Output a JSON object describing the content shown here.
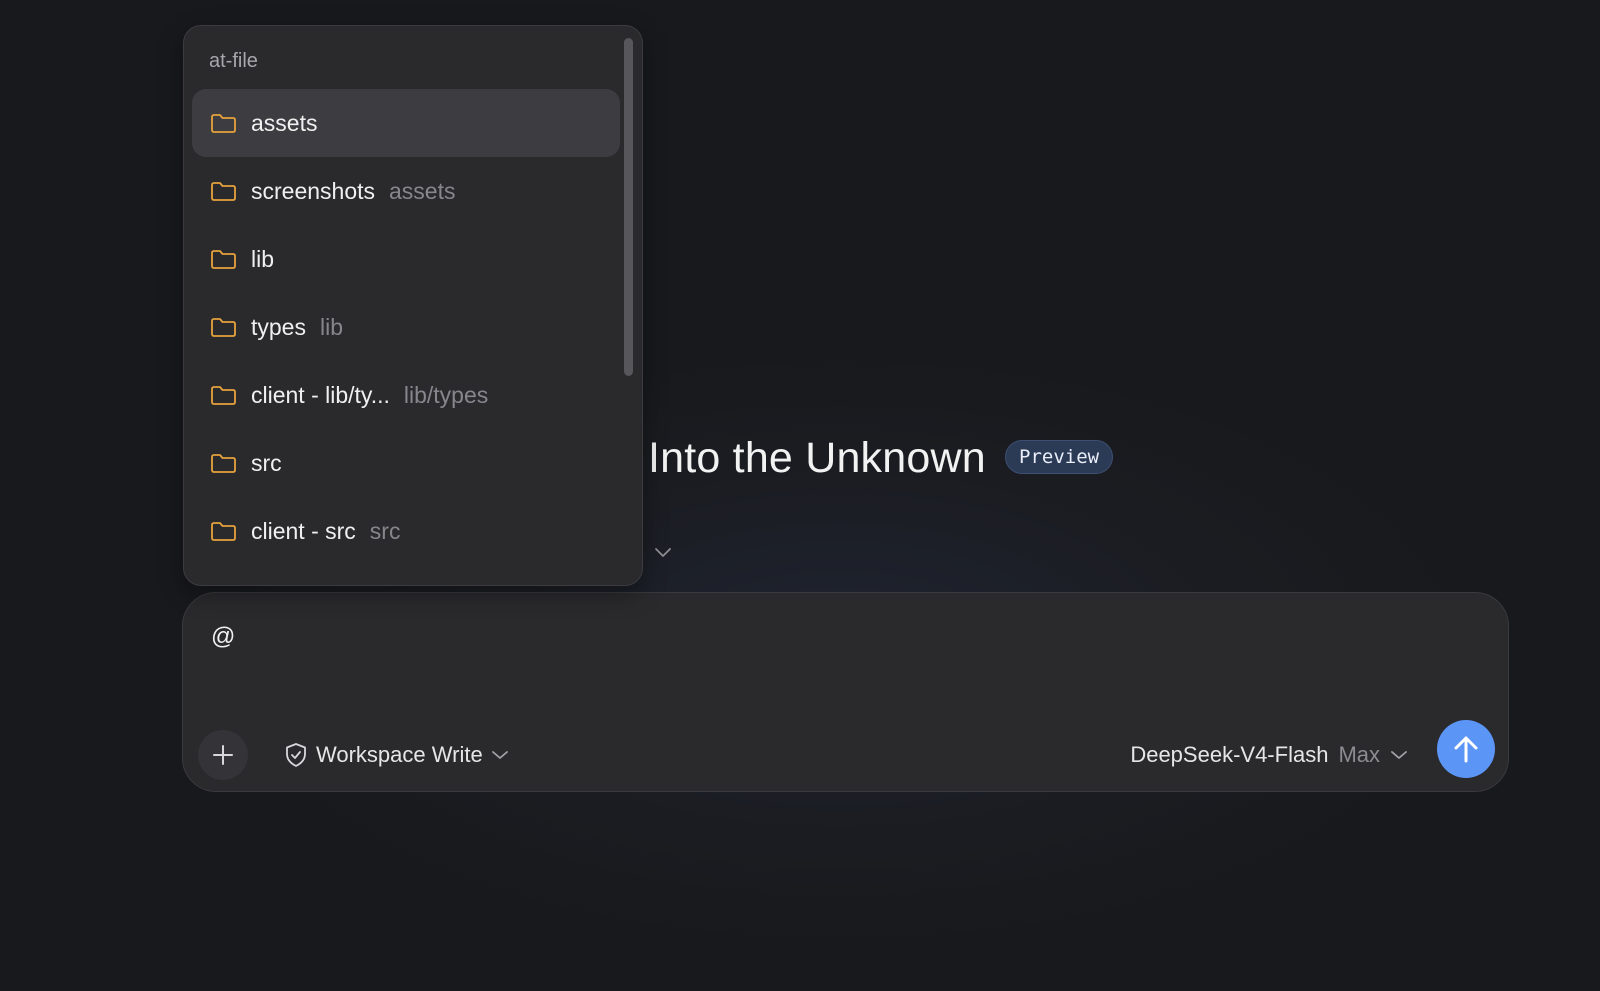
{
  "header": {
    "title": "Into the Unknown",
    "badge": "Preview"
  },
  "popup": {
    "header": "at-file",
    "items": [
      {
        "name": "assets",
        "path": "",
        "selected": true
      },
      {
        "name": "screenshots",
        "path": "assets"
      },
      {
        "name": "lib",
        "path": ""
      },
      {
        "name": "types",
        "path": "lib"
      },
      {
        "name": "client - lib/ty...",
        "path": "lib/types"
      },
      {
        "name": "src",
        "path": ""
      },
      {
        "name": "client - src",
        "path": "src"
      }
    ]
  },
  "composer": {
    "input_value": "@",
    "mode_label": "Workspace Write",
    "model_name": "DeepSeek-V4-Flash",
    "model_effort": "Max"
  },
  "icons": {
    "folder": "folder-icon",
    "plus": "plus-icon",
    "mode": "shield-check-icon",
    "chevron": "chevron-down-icon",
    "send": "arrow-up-icon"
  },
  "colors": {
    "accent": "#5b95f5",
    "folder": "#e6a23c",
    "badge_bg": "#2b3a55"
  }
}
